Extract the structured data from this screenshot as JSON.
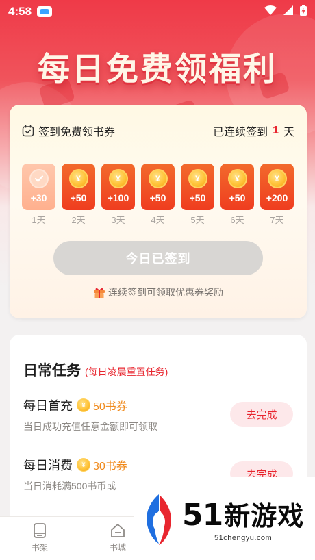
{
  "status_bar": {
    "time": "4:58"
  },
  "hero": {
    "title": "每日免费领福利"
  },
  "signin": {
    "label": "签到免费领书券",
    "streak_prefix": "已连续签到",
    "streak_days": "1",
    "streak_suffix": "天",
    "days": [
      {
        "reward": "+30",
        "label": "1天",
        "signed": true
      },
      {
        "reward": "+50",
        "label": "2天",
        "signed": false
      },
      {
        "reward": "+100",
        "label": "3天",
        "signed": false
      },
      {
        "reward": "+50",
        "label": "4天",
        "signed": false
      },
      {
        "reward": "+50",
        "label": "5天",
        "signed": false
      },
      {
        "reward": "+50",
        "label": "6天",
        "signed": false
      },
      {
        "reward": "+200",
        "label": "7天",
        "signed": false
      }
    ],
    "coin_symbol": "¥",
    "button_label": "今日已签到",
    "note": "连续签到可领取优惠券奖励"
  },
  "tasks": {
    "title": "日常任务",
    "subtitle": "(每日凌晨重置任务)",
    "items": [
      {
        "name": "每日首充",
        "reward": "50书券",
        "desc": "当日成功充值任意金额即可领取",
        "action": "去完成"
      },
      {
        "name": "每日消费",
        "reward": "30书券",
        "desc": "当日消耗满500书币或",
        "action": "去完成"
      }
    ]
  },
  "tabbar": {
    "items": [
      {
        "label": "书架",
        "icon": "bookshelf-icon"
      },
      {
        "label": "书城",
        "icon": "bookstore-icon"
      }
    ]
  },
  "watermark": {
    "num": "51",
    "text": "新游戏",
    "url": "51chengyu.com"
  },
  "colors": {
    "accent_red": "#e8262f",
    "tile_orange": "#ef3d1f",
    "reward_orange": "#f08a1c",
    "disabled_gray": "#d8d6d3"
  }
}
